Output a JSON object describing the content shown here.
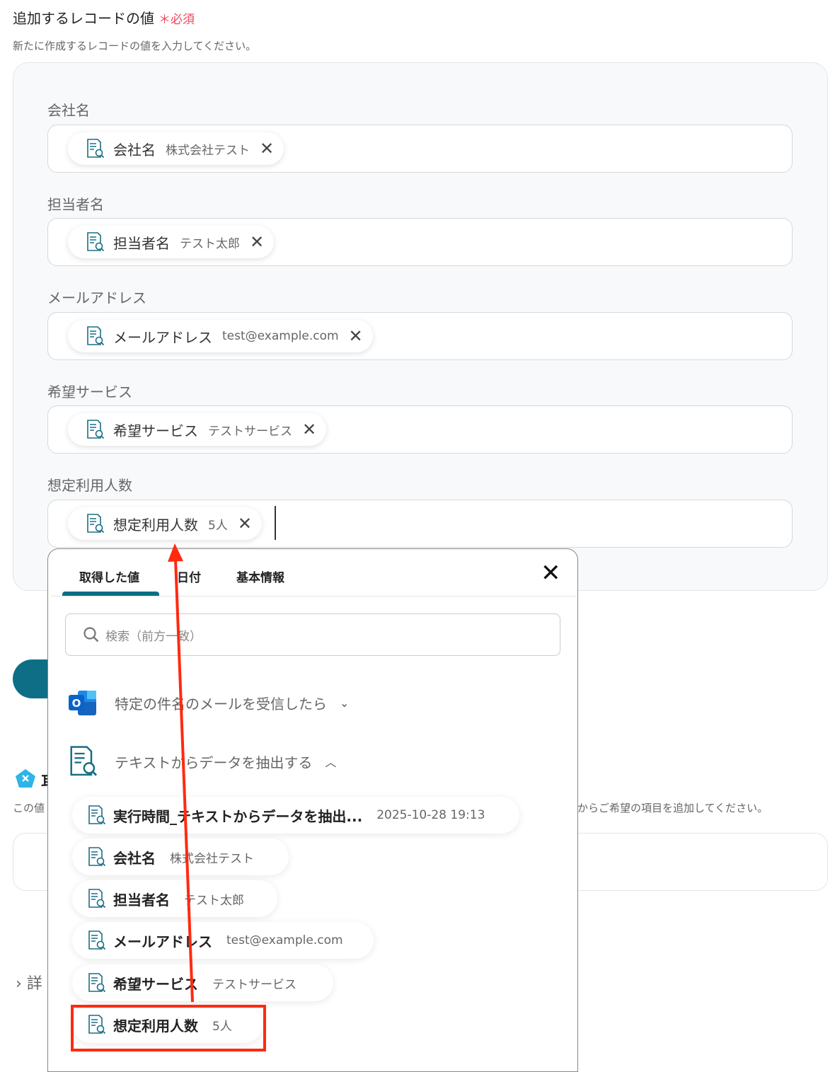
{
  "section": {
    "title": "追加するレコードの値",
    "required_mark": "＊",
    "required_label": "必須",
    "description": "新たに作成するレコードの値を入力してください。"
  },
  "fields": [
    {
      "label": "会社名",
      "chip_name": "会社名",
      "chip_value": "株式会社テスト"
    },
    {
      "label": "担当者名",
      "chip_name": "担当者名",
      "chip_value": "テスト太郎"
    },
    {
      "label": "メールアドレス",
      "chip_name": "メールアドレス",
      "chip_value": "test@example.com"
    },
    {
      "label": "希望サービス",
      "chip_name": "希望サービス",
      "chip_value": "テストサービス"
    },
    {
      "label": "想定利用人数",
      "chip_name": "想定利用人数",
      "chip_value": "5人"
    }
  ],
  "background": {
    "partial_text_1": "この値",
    "partial_text_2": "からご希望の項目を追加してください。",
    "partial_heading": "耳",
    "details_label": "詳"
  },
  "popup": {
    "tabs": [
      {
        "label": "取得した値",
        "active": true
      },
      {
        "label": "日付"
      },
      {
        "label": "基本情報"
      }
    ],
    "search_placeholder": "検索（前方一致）",
    "groups": [
      {
        "label": "特定の件名のメールを受信したら",
        "icon": "outlook-icon",
        "expanded": false
      },
      {
        "label": "テキストからデータを抽出する",
        "icon": "document-search-icon",
        "expanded": true
      }
    ],
    "items": [
      {
        "name": "実行時間_テキストからデータを抽出...",
        "value": "2025-10-28 19:13"
      },
      {
        "name": "会社名",
        "value": "株式会社テスト"
      },
      {
        "name": "担当者名",
        "value": "テスト太郎"
      },
      {
        "name": "メールアドレス",
        "value": "test@example.com"
      },
      {
        "name": "希望サービス",
        "value": "テストサービス"
      },
      {
        "name": "想定利用人数",
        "value": "5人",
        "highlighted": true
      }
    ]
  },
  "colors": {
    "accent": "#0d6e86",
    "required": "#f2445b",
    "annotation": "#ff2a10"
  }
}
